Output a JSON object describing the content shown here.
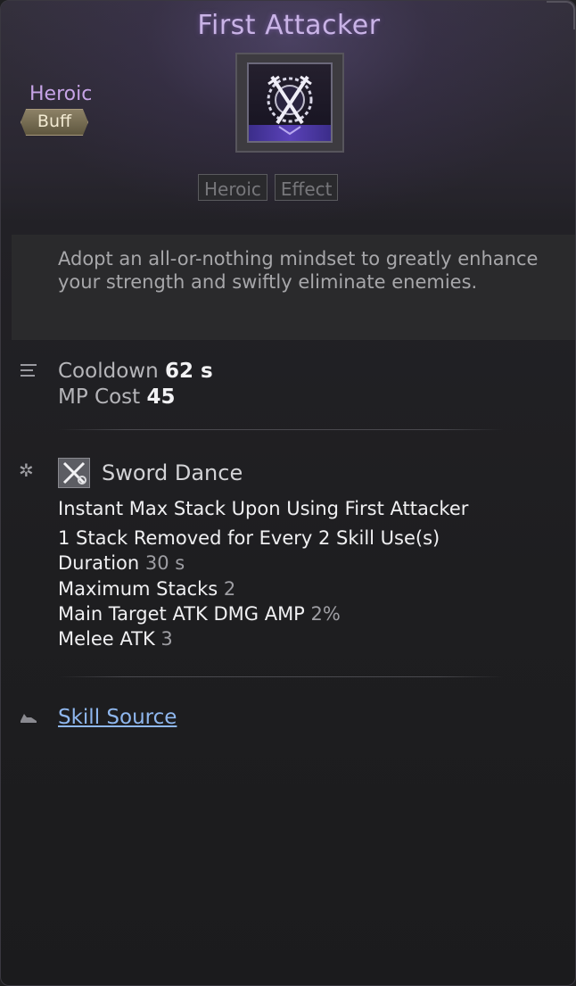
{
  "skill": {
    "title": "First Attacker",
    "grade": "Heroic",
    "type": "Buff",
    "icon": "crossed-swords-crest-icon",
    "tags": [
      "Heroic",
      "Effect"
    ],
    "description": "Adopt an all-or-nothing mindset to greatly enhance your strength and swiftly eliminate enemies."
  },
  "stats": {
    "cooldown_label": "Cooldown",
    "cooldown_value": "62 s",
    "mp_label": "MP Cost",
    "mp_value": "45"
  },
  "effect": {
    "name": "Sword Dance",
    "icon": "sword-dance-icon",
    "lines": [
      {
        "label": "Instant Max Stack Upon Using First Attacker",
        "value": ""
      },
      {
        "label": "1 Stack Removed for Every 2 Skill Use(s)",
        "value": ""
      },
      {
        "label": "Duration",
        "value": "30 s"
      },
      {
        "label": "Maximum Stacks",
        "value": "2"
      },
      {
        "label": "Main Target ATK DMG AMP",
        "value": "2%"
      },
      {
        "label": "Melee ATK",
        "value": "3"
      }
    ]
  },
  "source": {
    "label": "Skill Source"
  },
  "colors": {
    "title": "#c9b3e6",
    "grade": "#c6a3e6",
    "link": "#8fb7ee"
  }
}
